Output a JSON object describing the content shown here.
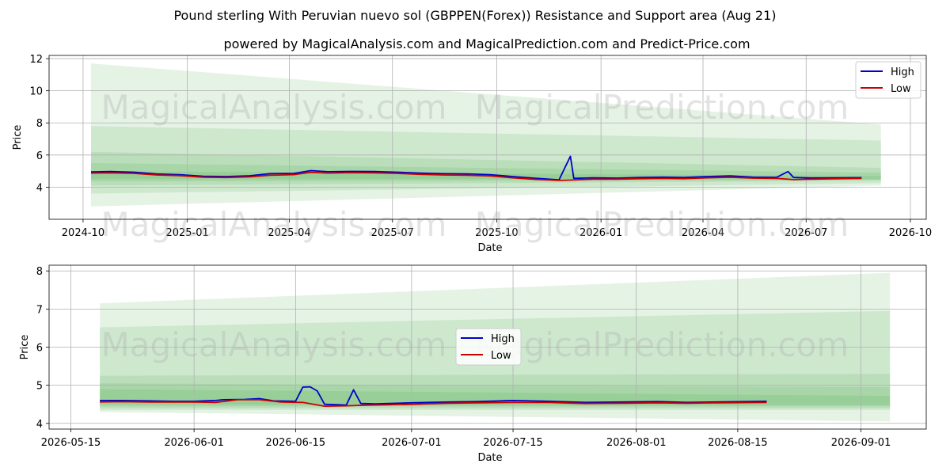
{
  "title": "Pound sterling With Peruvian nuevo sol (GBPPEN(Forex)) Resistance and Support area (Aug 21)",
  "subtitle": "powered by MagicalAnalysis.com and MagicalPrediction.com and Predict-Price.com",
  "watermarks": [
    "MagicalAnalysis.com",
    "MagicalPrediction.com"
  ],
  "colors": {
    "high": "#0000cc",
    "low": "#cc0000",
    "band": "#2ca02c",
    "grid": "#b0b0b0"
  },
  "chart_data": [
    {
      "type": "line",
      "name": "overview",
      "xlabel": "Date",
      "ylabel": "Price",
      "grid": true,
      "legend_placement": "top-right",
      "x_ticks": [
        "2024-10",
        "2025-01",
        "2025-04",
        "2025-07",
        "2025-10",
        "2026-01",
        "2026-04",
        "2026-07",
        "2026-10"
      ],
      "y_ticks": [
        4,
        6,
        8,
        10,
        12
      ],
      "ylim": [
        2.0,
        12.2
      ],
      "series": [
        {
          "name": "High",
          "points": [
            [
              "2024-10-08",
              4.95
            ],
            [
              "2024-10-25",
              4.97
            ],
            [
              "2024-11-15",
              4.93
            ],
            [
              "2024-12-05",
              4.82
            ],
            [
              "2024-12-25",
              4.78
            ],
            [
              "2025-01-15",
              4.68
            ],
            [
              "2025-02-05",
              4.66
            ],
            [
              "2025-02-25",
              4.71
            ],
            [
              "2025-03-15",
              4.84
            ],
            [
              "2025-04-05",
              4.86
            ],
            [
              "2025-04-20",
              5.03
            ],
            [
              "2025-05-05",
              4.96
            ],
            [
              "2025-05-25",
              4.98
            ],
            [
              "2025-06-15",
              4.97
            ],
            [
              "2025-07-05",
              4.93
            ],
            [
              "2025-07-25",
              4.88
            ],
            [
              "2025-08-15",
              4.84
            ],
            [
              "2025-09-05",
              4.83
            ],
            [
              "2025-09-25",
              4.78
            ],
            [
              "2025-10-15",
              4.66
            ],
            [
              "2025-11-05",
              4.55
            ],
            [
              "2025-11-25",
              4.46
            ],
            [
              "2025-12-05",
              5.92
            ],
            [
              "2025-12-08",
              4.55
            ],
            [
              "2025-12-25",
              4.58
            ],
            [
              "2026-01-15",
              4.56
            ],
            [
              "2026-02-05",
              4.6
            ],
            [
              "2026-02-25",
              4.62
            ],
            [
              "2026-03-15",
              4.6
            ],
            [
              "2026-04-05",
              4.66
            ],
            [
              "2026-04-25",
              4.7
            ],
            [
              "2026-05-15",
              4.62
            ],
            [
              "2026-06-05",
              4.61
            ],
            [
              "2026-06-15",
              4.97
            ],
            [
              "2026-06-20",
              4.6
            ],
            [
              "2026-07-05",
              4.57
            ],
            [
              "2026-07-25",
              4.58
            ],
            [
              "2026-08-19",
              4.59
            ]
          ]
        },
        {
          "name": "Low",
          "points": [
            [
              "2024-10-08",
              4.88
            ],
            [
              "2024-10-25",
              4.89
            ],
            [
              "2024-11-15",
              4.86
            ],
            [
              "2024-12-05",
              4.76
            ],
            [
              "2024-12-25",
              4.72
            ],
            [
              "2025-01-15",
              4.62
            ],
            [
              "2025-02-05",
              4.6
            ],
            [
              "2025-02-25",
              4.64
            ],
            [
              "2025-03-15",
              4.74
            ],
            [
              "2025-04-05",
              4.78
            ],
            [
              "2025-04-20",
              4.92
            ],
            [
              "2025-05-05",
              4.88
            ],
            [
              "2025-05-25",
              4.9
            ],
            [
              "2025-06-15",
              4.89
            ],
            [
              "2025-07-05",
              4.86
            ],
            [
              "2025-07-25",
              4.8
            ],
            [
              "2025-08-15",
              4.76
            ],
            [
              "2025-09-05",
              4.74
            ],
            [
              "2025-09-25",
              4.7
            ],
            [
              "2025-10-15",
              4.58
            ],
            [
              "2025-11-05",
              4.48
            ],
            [
              "2025-11-25",
              4.42
            ],
            [
              "2025-12-05",
              4.44
            ],
            [
              "2025-12-25",
              4.5
            ],
            [
              "2026-01-15",
              4.5
            ],
            [
              "2026-02-05",
              4.53
            ],
            [
              "2026-02-25",
              4.55
            ],
            [
              "2026-03-15",
              4.53
            ],
            [
              "2026-04-05",
              4.58
            ],
            [
              "2026-04-25",
              4.62
            ],
            [
              "2026-05-15",
              4.56
            ],
            [
              "2026-06-05",
              4.55
            ],
            [
              "2026-06-20",
              4.47
            ],
            [
              "2026-07-05",
              4.5
            ],
            [
              "2026-07-25",
              4.52
            ],
            [
              "2026-08-19",
              4.55
            ]
          ]
        }
      ],
      "bands": [
        {
          "from": "2024-10-08",
          "to": "2026-09-05",
          "start": [
            2.8,
            11.7
          ],
          "end": [
            4.1,
            7.9
          ]
        },
        {
          "from": "2024-10-08",
          "to": "2026-09-05",
          "start": [
            3.6,
            7.8
          ],
          "end": [
            4.25,
            6.9
          ]
        },
        {
          "from": "2024-10-08",
          "to": "2026-09-05",
          "start": [
            4.1,
            6.2
          ],
          "end": [
            4.4,
            5.2
          ]
        },
        {
          "from": "2024-10-08",
          "to": "2026-09-05",
          "start": [
            4.35,
            5.5
          ],
          "end": [
            4.45,
            4.9
          ]
        },
        {
          "from": "2024-10-08",
          "to": "2026-09-05",
          "start": [
            4.5,
            5.0
          ],
          "end": [
            4.5,
            4.7
          ]
        }
      ]
    },
    {
      "type": "line",
      "name": "recent",
      "xlabel": "Date",
      "ylabel": "Price",
      "grid": true,
      "legend_placement": "center",
      "x_ticks": [
        "2026-05-15",
        "2026-06-01",
        "2026-06-15",
        "2026-07-01",
        "2026-07-15",
        "2026-08-01",
        "2026-08-15",
        "2026-09-01"
      ],
      "y_ticks": [
        4,
        5,
        6,
        7,
        8
      ],
      "ylim": [
        3.85,
        8.15
      ],
      "series": [
        {
          "name": "High",
          "points": [
            [
              "2026-05-19",
              4.6
            ],
            [
              "2026-05-22",
              4.6
            ],
            [
              "2026-05-26",
              4.59
            ],
            [
              "2026-05-29",
              4.58
            ],
            [
              "2026-06-01",
              4.58
            ],
            [
              "2026-06-04",
              4.6
            ],
            [
              "2026-06-05",
              4.62
            ],
            [
              "2026-06-08",
              4.63
            ],
            [
              "2026-06-10",
              4.65
            ],
            [
              "2026-06-12",
              4.59
            ],
            [
              "2026-06-15",
              4.58
            ],
            [
              "2026-06-16",
              4.95
            ],
            [
              "2026-06-17",
              4.96
            ],
            [
              "2026-06-18",
              4.85
            ],
            [
              "2026-06-19",
              4.5
            ],
            [
              "2026-06-22",
              4.48
            ],
            [
              "2026-06-23",
              4.88
            ],
            [
              "2026-06-24",
              4.52
            ],
            [
              "2026-06-26",
              4.51
            ],
            [
              "2026-07-01",
              4.54
            ],
            [
              "2026-07-06",
              4.56
            ],
            [
              "2026-07-10",
              4.57
            ],
            [
              "2026-07-15",
              4.6
            ],
            [
              "2026-07-20",
              4.58
            ],
            [
              "2026-07-25",
              4.55
            ],
            [
              "2026-07-30",
              4.56
            ],
            [
              "2026-08-04",
              4.57
            ],
            [
              "2026-08-08",
              4.55
            ],
            [
              "2026-08-12",
              4.56
            ],
            [
              "2026-08-19",
              4.58
            ]
          ]
        },
        {
          "name": "Low",
          "points": [
            [
              "2026-05-19",
              4.56
            ],
            [
              "2026-05-22",
              4.57
            ],
            [
              "2026-05-26",
              4.56
            ],
            [
              "2026-05-29",
              4.56
            ],
            [
              "2026-06-01",
              4.56
            ],
            [
              "2026-06-04",
              4.55
            ],
            [
              "2026-06-07",
              4.62
            ],
            [
              "2026-06-10",
              4.62
            ],
            [
              "2026-06-13",
              4.56
            ],
            [
              "2026-06-16",
              4.55
            ],
            [
              "2026-06-19",
              4.45
            ],
            [
              "2026-06-22",
              4.46
            ],
            [
              "2026-06-25",
              4.48
            ],
            [
              "2026-06-28",
              4.49
            ],
            [
              "2026-07-01",
              4.5
            ],
            [
              "2026-07-06",
              4.53
            ],
            [
              "2026-07-10",
              4.54
            ],
            [
              "2026-07-15",
              4.55
            ],
            [
              "2026-07-20",
              4.55
            ],
            [
              "2026-07-25",
              4.52
            ],
            [
              "2026-07-30",
              4.53
            ],
            [
              "2026-08-04",
              4.54
            ],
            [
              "2026-08-08",
              4.53
            ],
            [
              "2026-08-12",
              4.54
            ],
            [
              "2026-08-19",
              4.55
            ]
          ]
        }
      ],
      "bands": [
        {
          "from": "2026-05-19",
          "to": "2026-09-05",
          "start": [
            4.3,
            7.15
          ],
          "end": [
            4.05,
            7.95
          ]
        },
        {
          "from": "2026-05-19",
          "to": "2026-09-05",
          "start": [
            4.35,
            6.52
          ],
          "end": [
            4.35,
            6.95
          ]
        },
        {
          "from": "2026-05-19",
          "to": "2026-09-05",
          "start": [
            4.4,
            5.25
          ],
          "end": [
            4.4,
            5.3
          ]
        },
        {
          "from": "2026-05-19",
          "to": "2026-09-05",
          "start": [
            4.45,
            5.05
          ],
          "end": [
            4.45,
            4.95
          ]
        },
        {
          "from": "2026-05-19",
          "to": "2026-09-05",
          "start": [
            4.5,
            4.9
          ],
          "end": [
            4.48,
            4.72
          ]
        }
      ]
    }
  ]
}
